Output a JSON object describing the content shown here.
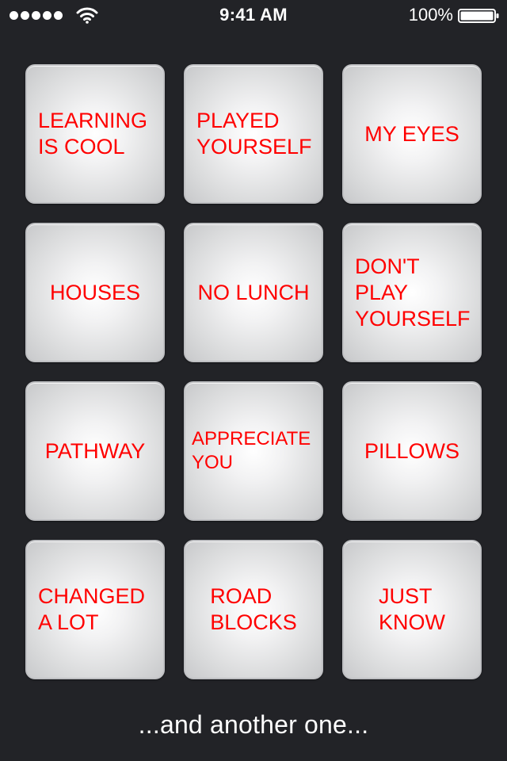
{
  "status_bar": {
    "signal_icon": "signal-dots-icon",
    "wifi_icon": "wifi-icon",
    "time": "9:41 AM",
    "battery_percent": "100%",
    "battery_icon": "battery-full-icon"
  },
  "buttons": [
    {
      "label": "LEARNING\nIS COOL"
    },
    {
      "label": "PLAYED\nYOURSELF"
    },
    {
      "label": "MY EYES"
    },
    {
      "label": "HOUSES"
    },
    {
      "label": "NO LUNCH"
    },
    {
      "label": "DON'T\nPLAY\nYOURSELF"
    },
    {
      "label": "PATHWAY"
    },
    {
      "label": "APPRECIATE\nYOU"
    },
    {
      "label": "PILLOWS"
    },
    {
      "label": "CHANGED\nA LOT"
    },
    {
      "label": "ROAD\nBLOCKS"
    },
    {
      "label": "JUST\nKNOW"
    }
  ],
  "caption": "...and another one...",
  "colors": {
    "background": "#222327",
    "label_red": "#ff0000",
    "tile_light": "#ffffff",
    "tile_edge": "#c8c9cb"
  }
}
